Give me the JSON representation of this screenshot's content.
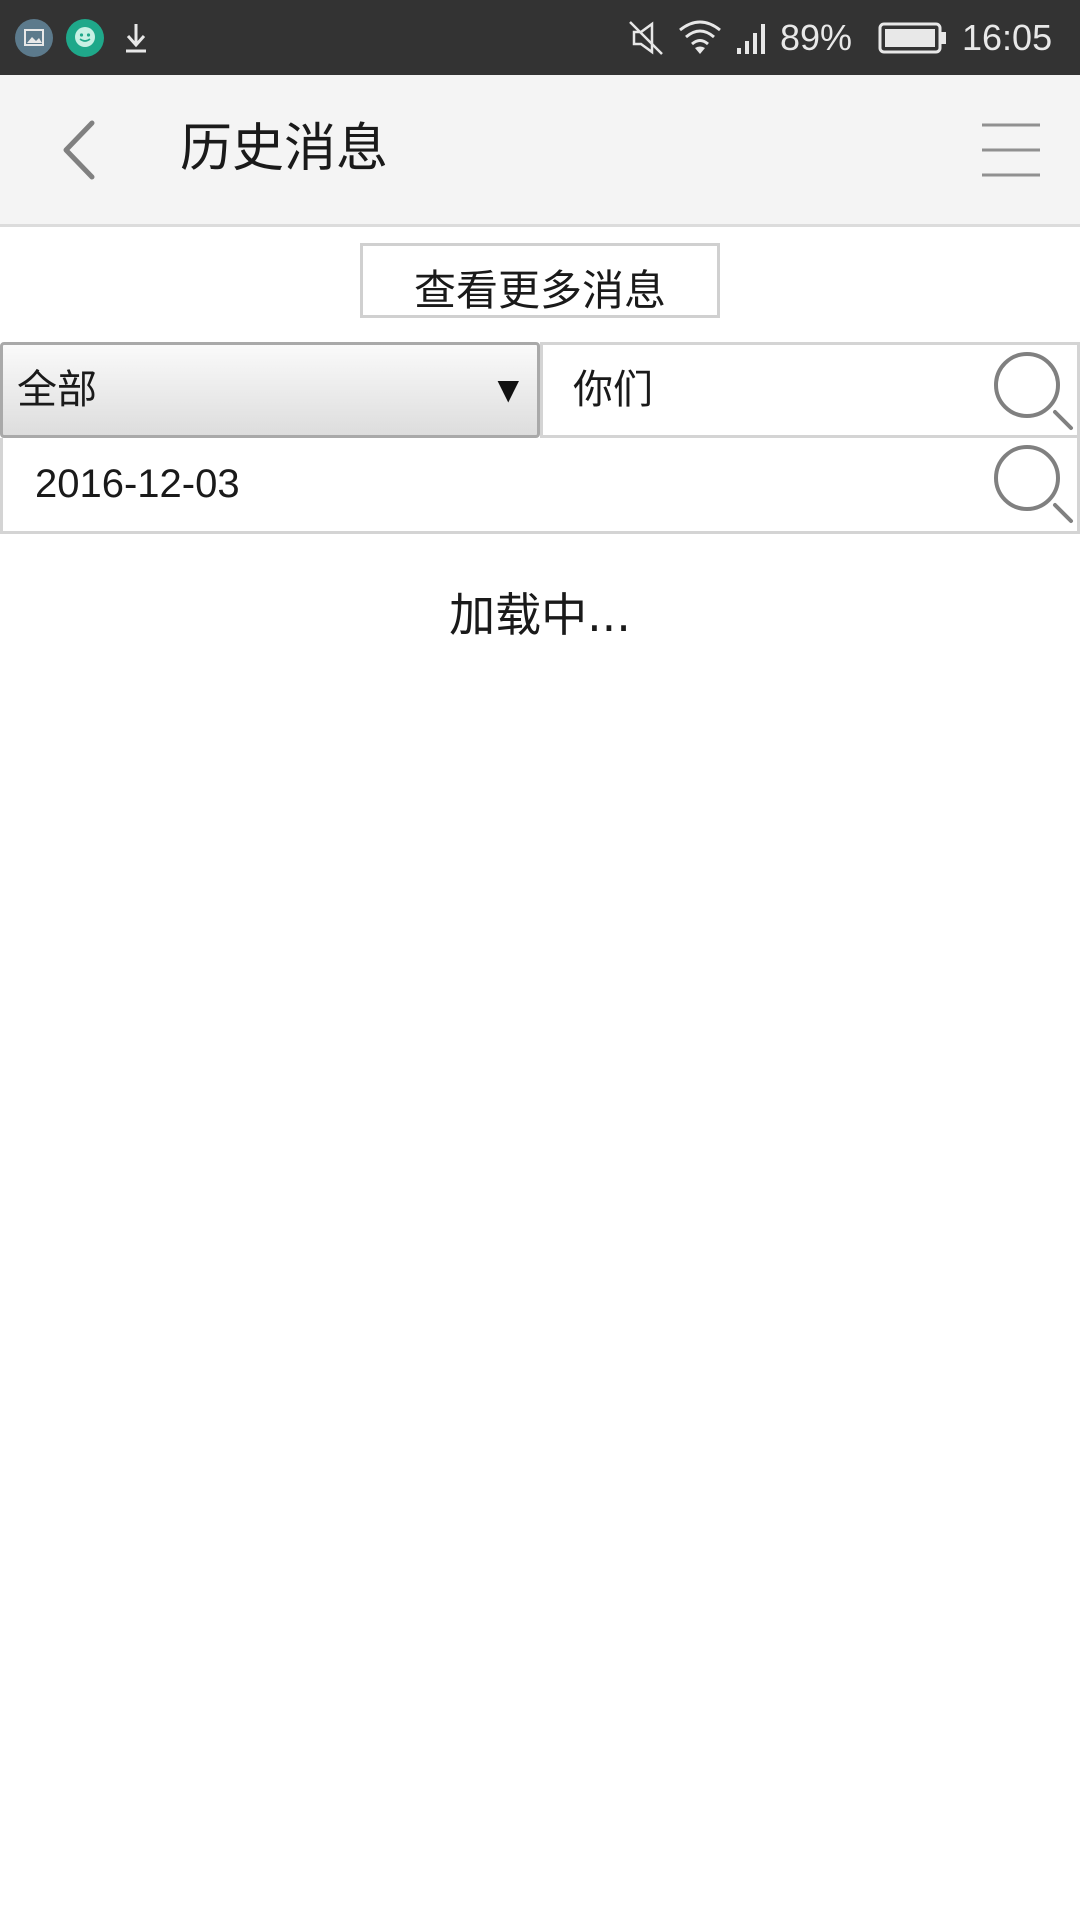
{
  "status_bar": {
    "left_icons": [
      "screenshot-icon",
      "messenger-app-icon",
      "download-icon"
    ],
    "right_icons": [
      "mute-icon",
      "wifi-icon",
      "signal-icon",
      "battery-icon"
    ],
    "battery_percent": "89%",
    "time": "16:05"
  },
  "header": {
    "title": "历史消息",
    "back_icon": "back-chevron-icon",
    "menu_icon": "menu-icon"
  },
  "main": {
    "more_messages_label": "查看更多消息",
    "filter": {
      "category_selected": "全部",
      "keyword_value": "你们",
      "date_value": "2016-12-03"
    },
    "loading_text": "加载中..."
  },
  "colors": {
    "status_bar_bg": "#333333",
    "title_bar_bg": "#f4f4f4",
    "border": "#d4d4d4",
    "icon_gray": "#808080"
  }
}
